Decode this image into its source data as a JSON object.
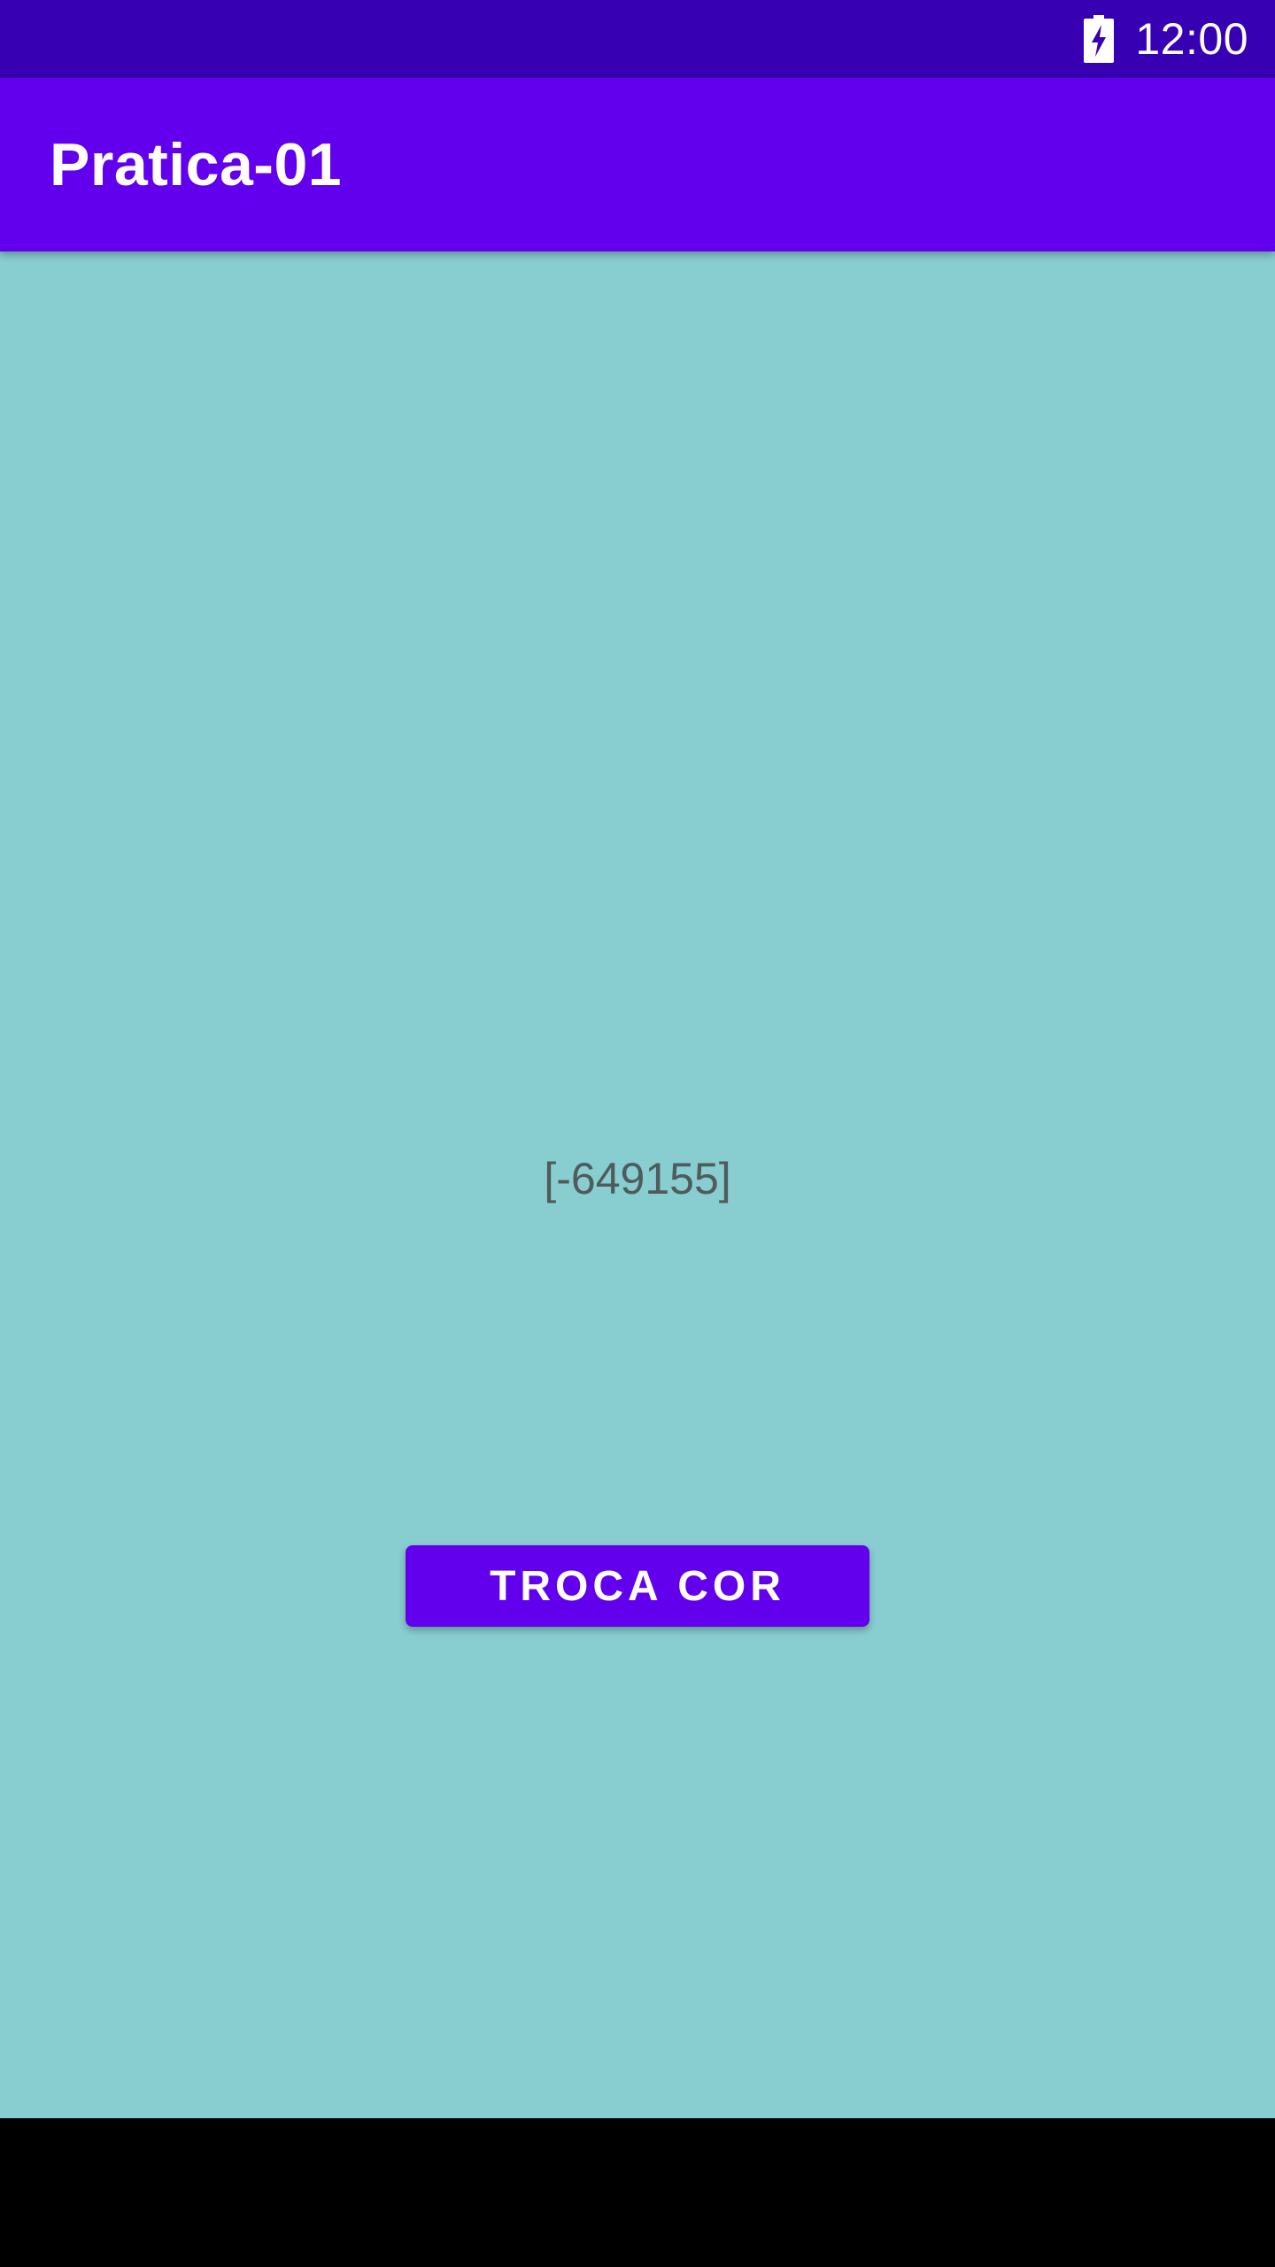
{
  "status_bar": {
    "time": "12:00",
    "battery_icon": "battery-charging-icon"
  },
  "app_bar": {
    "title": "Pratica-01"
  },
  "main": {
    "color_value": "[-649155]",
    "button_label": "TROCA COR"
  },
  "colors": {
    "status_bar": "#3700B3",
    "primary": "#6200EE",
    "background": "#88CDCF",
    "value_text": "#4F5B5C",
    "navigation_bar": "#000000"
  }
}
